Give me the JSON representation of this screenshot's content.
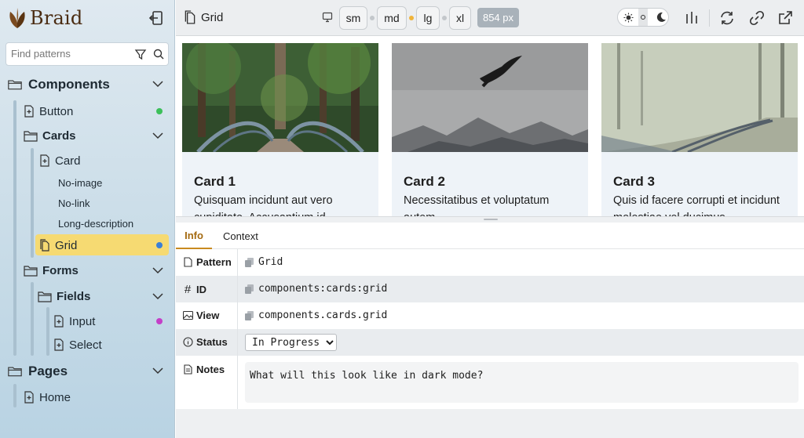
{
  "brand": {
    "name": "Braid",
    "color": "#4a2c12"
  },
  "sidebar": {
    "search_placeholder": "Find patterns",
    "components": "Components",
    "button": "Button",
    "cards": "Cards",
    "card": "Card",
    "no_image": "No-image",
    "no_link": "No-link",
    "long_description": "Long-description",
    "grid": "Grid",
    "forms": "Forms",
    "fields": "Fields",
    "input": "Input",
    "select": "Select",
    "pages": "Pages",
    "home": "Home",
    "status_colors": {
      "button": "#3cc05a",
      "grid": "#3b7fd6",
      "input": "#c43fc8"
    },
    "active_color": "#f6da72"
  },
  "toolbar": {
    "title": "Grid",
    "breakpoints": [
      "sm",
      "md",
      "lg",
      "xl"
    ],
    "active_breakpoint": "lg",
    "active_dot_color": "#f0b43a",
    "width_badge": "854 px"
  },
  "cards": [
    {
      "title": "Card 1",
      "text": "Quisquam incidunt aut vero cupiditate. Accusantium id",
      "image": "bridge-in-forest"
    },
    {
      "title": "Card 2",
      "text": "Necessitatibus et voluptatum autem.",
      "image": "bird-over-foggy-mountains"
    },
    {
      "title": "Card 3",
      "text": "Quis id facere corrupti et incidunt molestiae vel ducimus",
      "image": "railway-in-foggy-forest"
    }
  ],
  "tabs": {
    "info": "Info",
    "context": "Context"
  },
  "info": {
    "pattern_label": "Pattern",
    "pattern_value": "Grid",
    "id_label": "ID",
    "id_value": "components:cards:grid",
    "view_label": "View",
    "view_value": "components.cards.grid",
    "status_label": "Status",
    "status_value": "In Progress",
    "notes_label": "Notes",
    "notes_value": "What will this look like in dark mode?"
  }
}
